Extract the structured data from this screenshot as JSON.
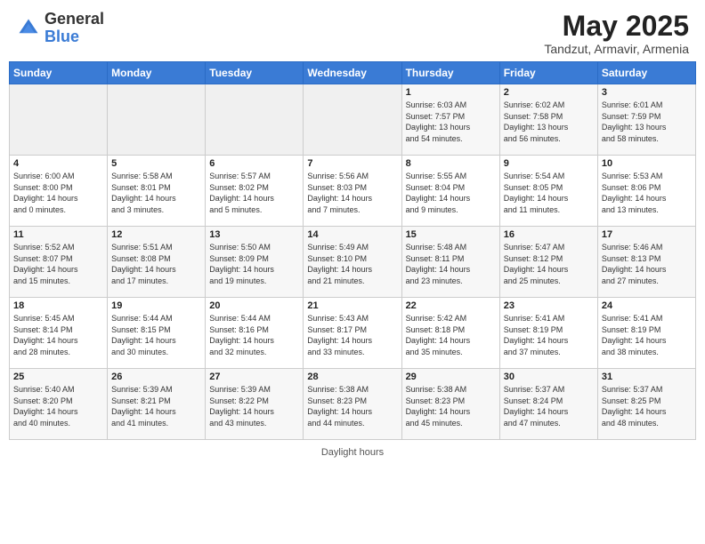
{
  "header": {
    "logo_line1": "General",
    "logo_line2": "Blue",
    "title": "May 2025",
    "subtitle": "Tandzut, Armavir, Armenia"
  },
  "calendar": {
    "weekdays": [
      "Sunday",
      "Monday",
      "Tuesday",
      "Wednesday",
      "Thursday",
      "Friday",
      "Saturday"
    ],
    "weeks": [
      [
        {
          "day": "",
          "info": ""
        },
        {
          "day": "",
          "info": ""
        },
        {
          "day": "",
          "info": ""
        },
        {
          "day": "",
          "info": ""
        },
        {
          "day": "1",
          "info": "Sunrise: 6:03 AM\nSunset: 7:57 PM\nDaylight: 13 hours\nand 54 minutes."
        },
        {
          "day": "2",
          "info": "Sunrise: 6:02 AM\nSunset: 7:58 PM\nDaylight: 13 hours\nand 56 minutes."
        },
        {
          "day": "3",
          "info": "Sunrise: 6:01 AM\nSunset: 7:59 PM\nDaylight: 13 hours\nand 58 minutes."
        }
      ],
      [
        {
          "day": "4",
          "info": "Sunrise: 6:00 AM\nSunset: 8:00 PM\nDaylight: 14 hours\nand 0 minutes."
        },
        {
          "day": "5",
          "info": "Sunrise: 5:58 AM\nSunset: 8:01 PM\nDaylight: 14 hours\nand 3 minutes."
        },
        {
          "day": "6",
          "info": "Sunrise: 5:57 AM\nSunset: 8:02 PM\nDaylight: 14 hours\nand 5 minutes."
        },
        {
          "day": "7",
          "info": "Sunrise: 5:56 AM\nSunset: 8:03 PM\nDaylight: 14 hours\nand 7 minutes."
        },
        {
          "day": "8",
          "info": "Sunrise: 5:55 AM\nSunset: 8:04 PM\nDaylight: 14 hours\nand 9 minutes."
        },
        {
          "day": "9",
          "info": "Sunrise: 5:54 AM\nSunset: 8:05 PM\nDaylight: 14 hours\nand 11 minutes."
        },
        {
          "day": "10",
          "info": "Sunrise: 5:53 AM\nSunset: 8:06 PM\nDaylight: 14 hours\nand 13 minutes."
        }
      ],
      [
        {
          "day": "11",
          "info": "Sunrise: 5:52 AM\nSunset: 8:07 PM\nDaylight: 14 hours\nand 15 minutes."
        },
        {
          "day": "12",
          "info": "Sunrise: 5:51 AM\nSunset: 8:08 PM\nDaylight: 14 hours\nand 17 minutes."
        },
        {
          "day": "13",
          "info": "Sunrise: 5:50 AM\nSunset: 8:09 PM\nDaylight: 14 hours\nand 19 minutes."
        },
        {
          "day": "14",
          "info": "Sunrise: 5:49 AM\nSunset: 8:10 PM\nDaylight: 14 hours\nand 21 minutes."
        },
        {
          "day": "15",
          "info": "Sunrise: 5:48 AM\nSunset: 8:11 PM\nDaylight: 14 hours\nand 23 minutes."
        },
        {
          "day": "16",
          "info": "Sunrise: 5:47 AM\nSunset: 8:12 PM\nDaylight: 14 hours\nand 25 minutes."
        },
        {
          "day": "17",
          "info": "Sunrise: 5:46 AM\nSunset: 8:13 PM\nDaylight: 14 hours\nand 27 minutes."
        }
      ],
      [
        {
          "day": "18",
          "info": "Sunrise: 5:45 AM\nSunset: 8:14 PM\nDaylight: 14 hours\nand 28 minutes."
        },
        {
          "day": "19",
          "info": "Sunrise: 5:44 AM\nSunset: 8:15 PM\nDaylight: 14 hours\nand 30 minutes."
        },
        {
          "day": "20",
          "info": "Sunrise: 5:44 AM\nSunset: 8:16 PM\nDaylight: 14 hours\nand 32 minutes."
        },
        {
          "day": "21",
          "info": "Sunrise: 5:43 AM\nSunset: 8:17 PM\nDaylight: 14 hours\nand 33 minutes."
        },
        {
          "day": "22",
          "info": "Sunrise: 5:42 AM\nSunset: 8:18 PM\nDaylight: 14 hours\nand 35 minutes."
        },
        {
          "day": "23",
          "info": "Sunrise: 5:41 AM\nSunset: 8:19 PM\nDaylight: 14 hours\nand 37 minutes."
        },
        {
          "day": "24",
          "info": "Sunrise: 5:41 AM\nSunset: 8:19 PM\nDaylight: 14 hours\nand 38 minutes."
        }
      ],
      [
        {
          "day": "25",
          "info": "Sunrise: 5:40 AM\nSunset: 8:20 PM\nDaylight: 14 hours\nand 40 minutes."
        },
        {
          "day": "26",
          "info": "Sunrise: 5:39 AM\nSunset: 8:21 PM\nDaylight: 14 hours\nand 41 minutes."
        },
        {
          "day": "27",
          "info": "Sunrise: 5:39 AM\nSunset: 8:22 PM\nDaylight: 14 hours\nand 43 minutes."
        },
        {
          "day": "28",
          "info": "Sunrise: 5:38 AM\nSunset: 8:23 PM\nDaylight: 14 hours\nand 44 minutes."
        },
        {
          "day": "29",
          "info": "Sunrise: 5:38 AM\nSunset: 8:23 PM\nDaylight: 14 hours\nand 45 minutes."
        },
        {
          "day": "30",
          "info": "Sunrise: 5:37 AM\nSunset: 8:24 PM\nDaylight: 14 hours\nand 47 minutes."
        },
        {
          "day": "31",
          "info": "Sunrise: 5:37 AM\nSunset: 8:25 PM\nDaylight: 14 hours\nand 48 minutes."
        }
      ]
    ]
  },
  "footer": {
    "note": "Daylight hours"
  }
}
